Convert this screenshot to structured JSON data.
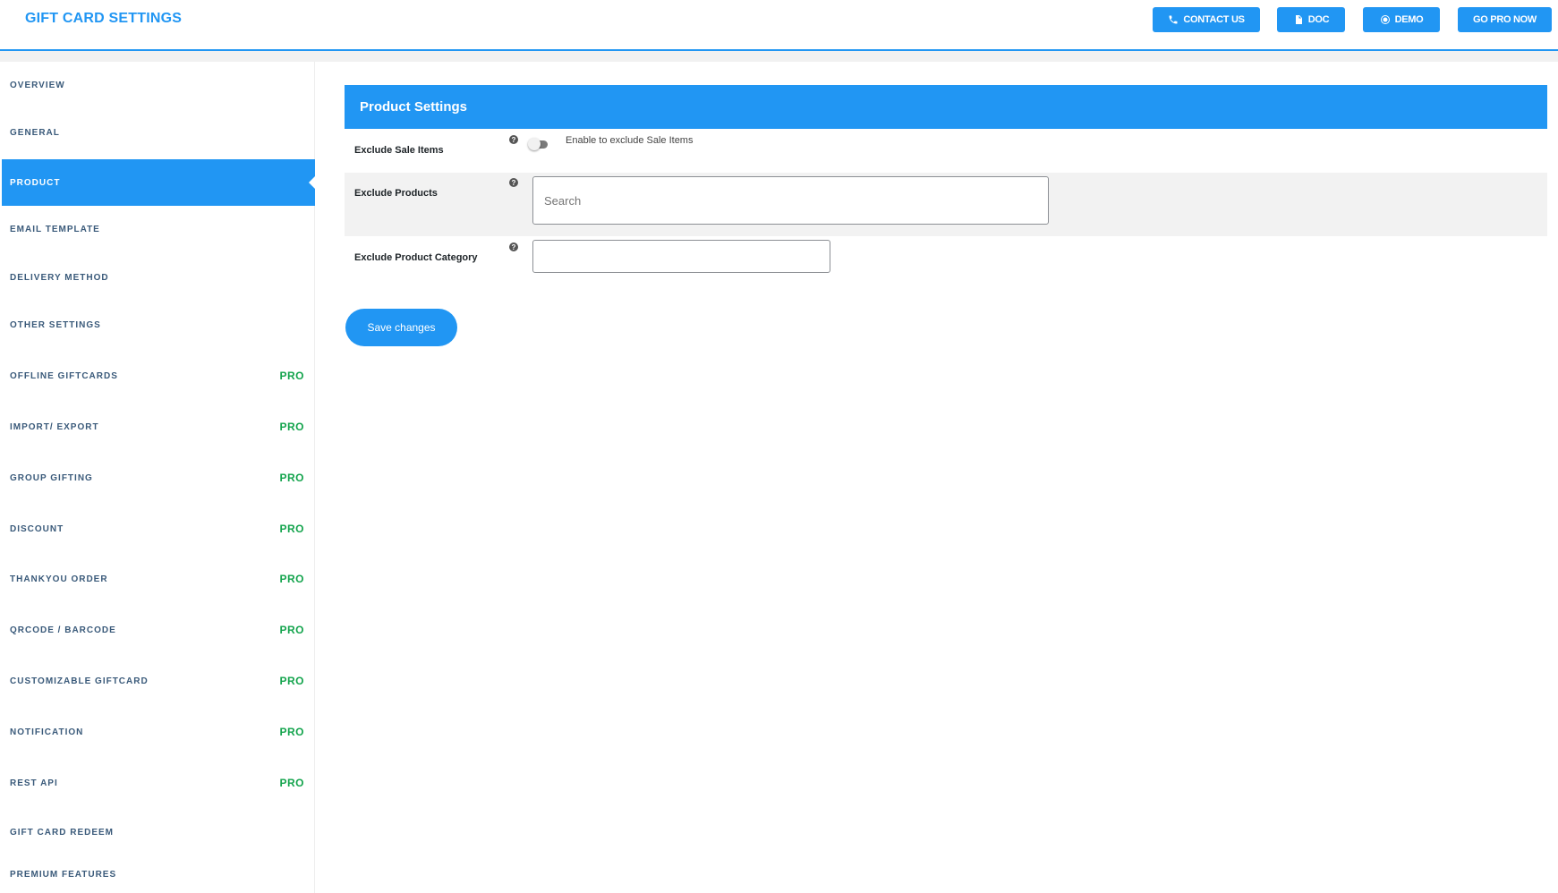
{
  "header": {
    "title": "GIFT CARD SETTINGS",
    "buttons": {
      "contact": "CONTACT US",
      "doc": "DOC",
      "demo": "DEMO",
      "gopro": "GO PRO NOW"
    },
    "icons": {
      "contact": "phone-icon",
      "doc": "document-icon",
      "demo": "play-circle-icon"
    }
  },
  "sidebar": {
    "items": [
      {
        "label": "OVERVIEW",
        "pro": ""
      },
      {
        "label": "GENERAL",
        "pro": ""
      },
      {
        "label": "PRODUCT",
        "pro": "",
        "active": true
      },
      {
        "label": "EMAIL TEMPLATE",
        "pro": ""
      },
      {
        "label": "DELIVERY METHOD",
        "pro": ""
      },
      {
        "label": "OTHER SETTINGS",
        "pro": ""
      },
      {
        "label": "OFFLINE GIFTCARDS",
        "pro": "PRO"
      },
      {
        "label": "IMPORT/ EXPORT",
        "pro": "PRO"
      },
      {
        "label": "GROUP GIFTING",
        "pro": "PRO"
      },
      {
        "label": "DISCOUNT",
        "pro": "PRO"
      },
      {
        "label": "THANKYOU ORDER",
        "pro": "PRO"
      },
      {
        "label": "QRCODE / BARCODE",
        "pro": "PRO"
      },
      {
        "label": "CUSTOMIZABLE GIFTCARD",
        "pro": "PRO"
      },
      {
        "label": "NOTIFICATION",
        "pro": "PRO"
      },
      {
        "label": "REST API",
        "pro": "PRO"
      },
      {
        "label": "GIFT CARD REDEEM",
        "pro": ""
      },
      {
        "label": "PREMIUM FEATURES",
        "pro": ""
      }
    ]
  },
  "main": {
    "panel_title": "Product Settings",
    "exclude_sale": {
      "label": "Exclude Sale Items",
      "help": "?",
      "toggle_text": "Enable to exclude Sale Items",
      "enabled": false
    },
    "exclude_products": {
      "label": "Exclude Products",
      "help": "?",
      "placeholder": "Search"
    },
    "exclude_category": {
      "label": "Exclude Product Category",
      "help": "?"
    },
    "save_label": "Save changes"
  },
  "colors": {
    "accent": "#2196f3",
    "pro": "#14a44d"
  }
}
